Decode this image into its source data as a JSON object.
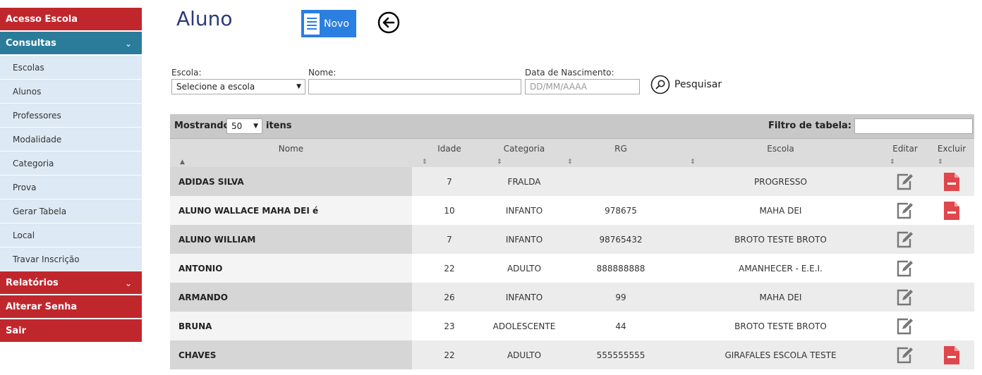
{
  "sidebar": {
    "acesso_escola": "Acesso Escola",
    "consultas": "Consultas",
    "consultas_items": [
      "Escolas",
      "Alunos",
      "Professores",
      "Modalidade",
      "Categoria",
      "Prova",
      "Gerar Tabela",
      "Local",
      "Travar Inscrição"
    ],
    "relatorios": "Relatórios",
    "alterar_senha": "Alterar Senha",
    "sair": "Sair"
  },
  "header": {
    "title": "Aluno",
    "new_label": "Novo"
  },
  "filters": {
    "school_label": "Escola:",
    "school_value": "Selecione a escola",
    "name_label": "Nome:",
    "name_value": "",
    "date_label": "Data de Nascimento:",
    "date_placeholder": "DD/MM/AAAA",
    "search_label": "Pesquisar"
  },
  "table": {
    "show_label": "Mostrando",
    "page_size": "50",
    "items_label": "itens",
    "filter_label": "Filtro de tabela:",
    "columns": [
      "Nome",
      "Idade",
      "Categoria",
      "RG",
      "Escola",
      "Editar",
      "Excluir"
    ],
    "rows": [
      {
        "nome": "ADIDAS SILVA",
        "idade": "7",
        "categoria": "FRALDA",
        "rg": "",
        "escola": "PROGRESSO",
        "excluir": true
      },
      {
        "nome": "ALUNO WALLACE MAHA DEI é",
        "idade": "10",
        "categoria": "INFANTO",
        "rg": "978675",
        "escola": "MAHA DEI",
        "excluir": true
      },
      {
        "nome": "ALUNO WILLIAM",
        "idade": "7",
        "categoria": "INFANTO",
        "rg": "98765432",
        "escola": "BROTO TESTE BROTO",
        "excluir": false
      },
      {
        "nome": "ANTONIO",
        "idade": "22",
        "categoria": "ADULTO",
        "rg": "888888888",
        "escola": "AMANHECER - E.E.I.",
        "excluir": false
      },
      {
        "nome": "ARMANDO",
        "idade": "26",
        "categoria": "INFANTO",
        "rg": "99",
        "escola": "MAHA DEI",
        "excluir": false
      },
      {
        "nome": "BRUNA",
        "idade": "23",
        "categoria": "ADOLESCENTE",
        "rg": "44",
        "escola": "BROTO TESTE BROTO",
        "excluir": false
      },
      {
        "nome": "CHAVES",
        "idade": "22",
        "categoria": "ADULTO",
        "rg": "555555555",
        "escola": "GIRAFALES ESCOLA TESTE",
        "excluir": true
      }
    ]
  },
  "icons": {
    "new": "document-icon",
    "back": "arrow-left-circle-icon",
    "search": "search-icon",
    "edit": "edit-icon",
    "delete": "delete-file-icon",
    "sort": "sort-icon",
    "chevron": "chevron-down-icon"
  },
  "colors": {
    "menu_red": "#c0272d",
    "menu_teal": "#2b7c9a",
    "submenu_bg": "#dde9f4",
    "title": "#2d3a7a",
    "button_blue": "#2b7fe0",
    "delete_red": "#e0474c"
  }
}
